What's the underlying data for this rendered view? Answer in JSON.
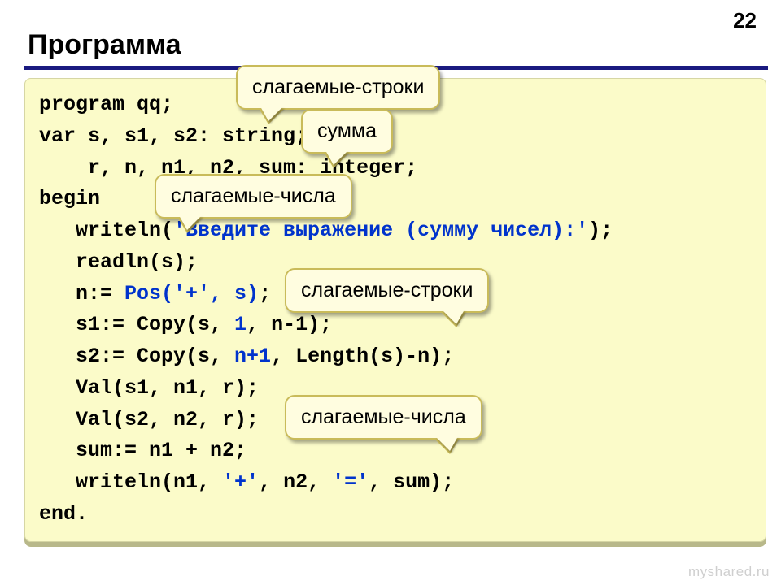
{
  "slide_number": "22",
  "title": "Программа",
  "code": {
    "l1": "program qq;",
    "l2": "var s, s1, s2: string;",
    "l3": "    r, n, n1, n2, sum: integer;",
    "l4": "begin",
    "l5a": "   writeln(",
    "l5b": "'Введите выражение (сумму чисел):'",
    "l5c": ");",
    "l6": "   readln(s);",
    "l7a": "   n:= ",
    "l7b": "Pos('+', s)",
    "l7c": ";",
    "l8a": "   s1:= Copy(s, ",
    "l8b": "1",
    "l8c": ", n-1);",
    "l9a": "   s2:= Copy(s, ",
    "l9b": "n+1",
    "l9c": ", Length(s)-n);",
    "l10": "   Val(s1, n1, r);",
    "l11": "   Val(s2, n2, r);",
    "l12": "   sum:= n1 + n2;",
    "l13a": "   writeln(n1, ",
    "l13b": "'+'",
    "l13c": ", n2, ",
    "l13d": "'='",
    "l13e": ", sum);",
    "l14": "end."
  },
  "callouts": {
    "c1": "слагаемые-строки",
    "c2": "сумма",
    "c3": "слагаемые-числа",
    "c4": "слагаемые-строки",
    "c5": "слагаемые-числа"
  },
  "watermark": "myshared.ru"
}
